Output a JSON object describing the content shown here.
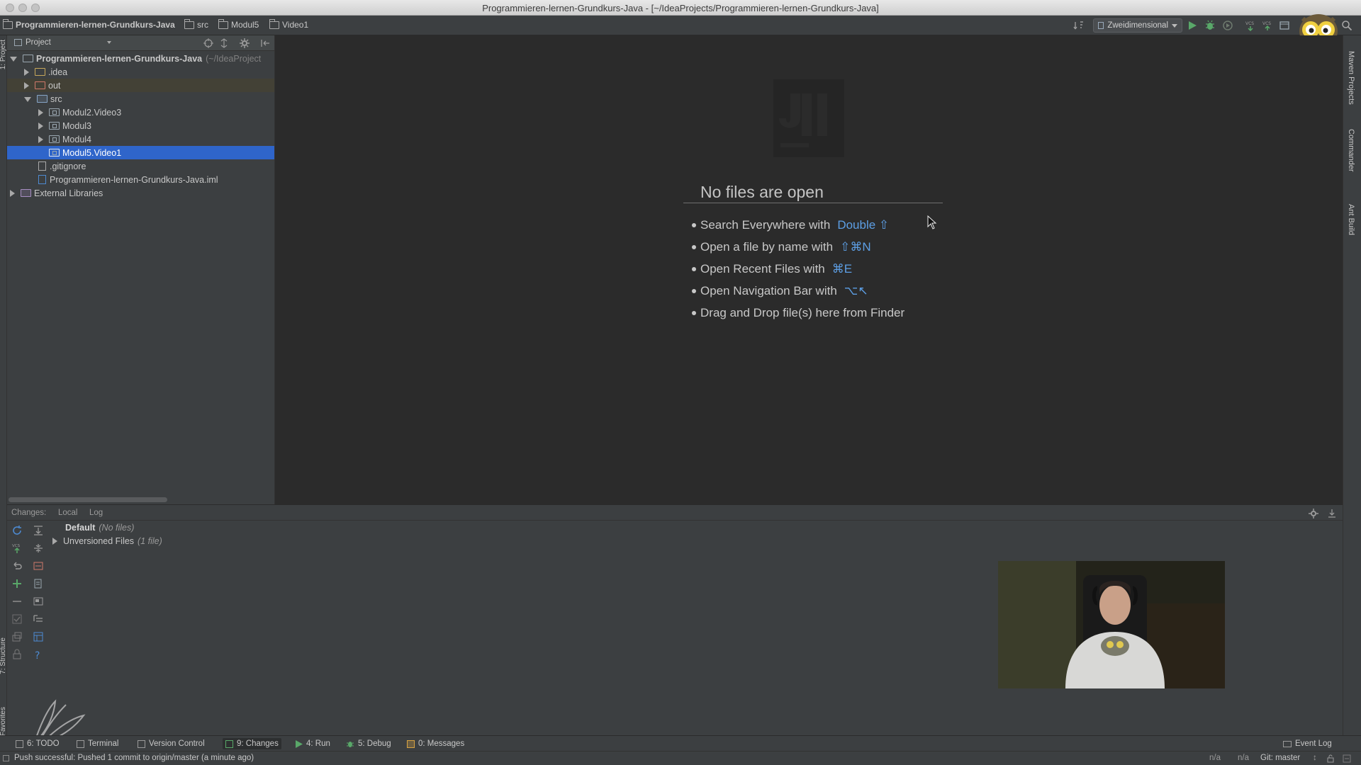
{
  "window": {
    "title": "Programmieren-lernen-Grundkurs-Java - [~/IdeaProjects/Programmieren-lernen-Grundkurs-Java]"
  },
  "navbar": {
    "crumbs": [
      "Programmieren-lernen-Grundkurs-Java",
      "src",
      "Modul5",
      "Video1"
    ],
    "run_config": "Zweidimensional"
  },
  "project_panel": {
    "title": "Project",
    "tree": [
      {
        "label": "Programmieren-lernen-Grundkurs-Java",
        "suffix": "(~/IdeaProject"
      },
      {
        "label": ".idea"
      },
      {
        "label": "out"
      },
      {
        "label": "src"
      },
      {
        "label": "Modul2.Video3"
      },
      {
        "label": "Modul3"
      },
      {
        "label": "Modul4"
      },
      {
        "label": "Modul5.Video1"
      },
      {
        "label": ".gitignore"
      },
      {
        "label": "Programmieren-lernen-Grundkurs-Java.iml"
      },
      {
        "label": "External Libraries"
      }
    ]
  },
  "editor": {
    "empty_title": "No files are open",
    "hints": [
      {
        "text": "Search Everywhere with",
        "key": "Double ⇧"
      },
      {
        "text": "Open a file by name with",
        "key": "⇧⌘N"
      },
      {
        "text": "Open Recent Files with",
        "key": "⌘E"
      },
      {
        "text": "Open Navigation Bar with",
        "key": "⌥↖"
      },
      {
        "text": "Drag and Drop file(s) here from Finder",
        "key": ""
      }
    ]
  },
  "right_stripe": {
    "tabs": [
      "Maven Projects",
      "Commander",
      "Ant Build"
    ]
  },
  "changes_panel": {
    "label": "Changes:",
    "tabs": [
      "Local",
      "Log"
    ],
    "rows": [
      {
        "name": "Default",
        "detail": "(No files)"
      },
      {
        "name": "Unversioned Files",
        "detail": "(1 file)"
      }
    ]
  },
  "tool_windows": {
    "buttons": [
      "6: TODO",
      "Terminal",
      "Version Control",
      "9: Changes",
      "4: Run",
      "5: Debug",
      "0: Messages"
    ],
    "event_log": "Event Log"
  },
  "statusbar": {
    "message": "Push successful: Pushed 1 commit to origin/master (a minute ago)",
    "na_1": "n/a",
    "na_2": "n/a",
    "git_branch": "Git: master"
  },
  "colors": {
    "selection": "#2f65ca",
    "shortcut_key": "#5d9fe5",
    "panel_bg": "#3c3f41",
    "editor_bg": "#2b2b2b"
  }
}
